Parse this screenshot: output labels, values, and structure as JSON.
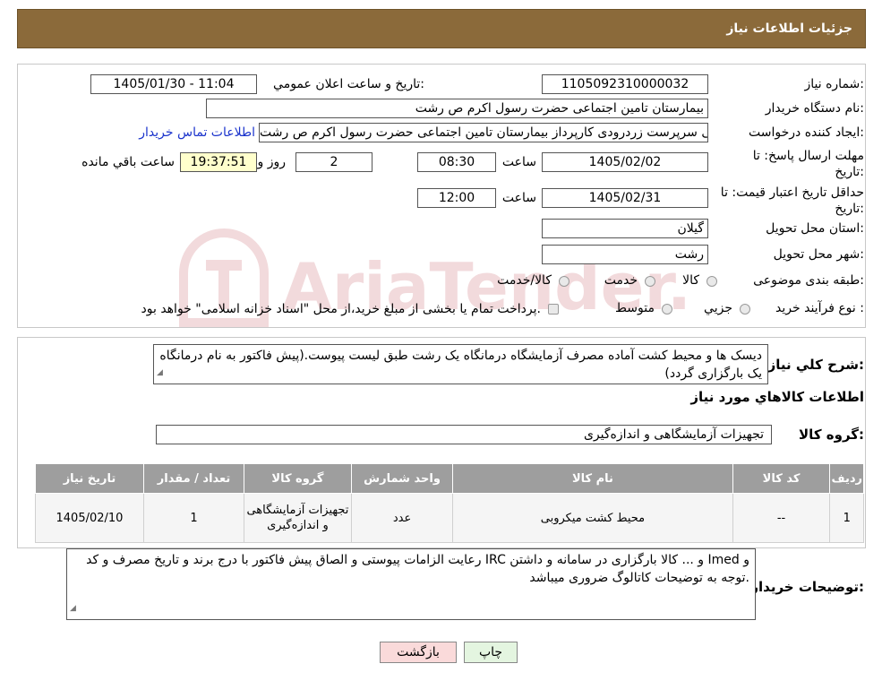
{
  "header": {
    "title": "جزئیات اطلاعات نیاز"
  },
  "fields": {
    "need_number_label": "شماره نیاز:",
    "need_number_value": "1105092310000032",
    "announce_label": "تاريخ و ساعت اعلان عمومي:",
    "announce_value": "1405/01/30 - 11:04",
    "buyer_org_label": "نام دستگاه خريدار:",
    "buyer_org_value": "بیمارستان  تامین اجتماعی حضرت رسول اکرم ص رشت",
    "requester_label": "ايجاد کننده درخواست:",
    "requester_value": "علی سرپرست زردرودی کارپرداز بیمارستان  تامین اجتماعی حضرت رسول اکرم ص رشت",
    "contact_link": "اطلاعات تماس خريدار",
    "deadline_label_1": "مهلت ارسال پاسخ: تا",
    "deadline_label_2": "تاريخ:",
    "deadline_date": "1405/02/02",
    "time_label": "ساعت",
    "deadline_time": "08:30",
    "days_value": "2",
    "days_label": "روز و",
    "remaining_time": "19:37:51",
    "remaining_label": "ساعت باقي مانده",
    "validity_label_1": "حداقل تاريخ اعتبار قيمت: تا",
    "validity_label_2": "تاريخ:",
    "validity_date": "1405/02/31",
    "validity_time": "12:00",
    "province_label": "استان محل تحويل:",
    "province_value": "گيلان",
    "city_label": "شهر محل تحويل:",
    "city_value": "رشت",
    "category_label": "طبقه بندی موضوعی:",
    "category_options": [
      "کالا",
      "خدمت",
      "کالا/خدمت"
    ],
    "process_label": "نوع فرآيند خريد :",
    "process_options": [
      "جزيي",
      "متوسط"
    ],
    "process_note": "پرداخت تمام يا بخشی از مبلغ خريد،از محل \"اسناد خزانه اسلامی\" خواهد بود."
  },
  "description": {
    "label": "شرح کلي نياز:",
    "text": "دیسک ها و محیط کشت آماده مصرف  آزمایشگاه درمانگاه یک رشت طبق لیست پیوست.(پیش فاکتور به نام درمانگاه یک بارگزاری گردد)"
  },
  "goods_info": {
    "heading": "اطلاعات کالاهاي مورد نياز",
    "group_label": "گروه کالا:",
    "group_value": "تجهیزات آزمایشگاهی و اندازه‌گیری"
  },
  "table": {
    "headers": [
      "رديف",
      "کد کالا",
      "نام کالا",
      "واحد شمارش",
      "گروه کالا",
      "تعداد / مقدار",
      "تاريخ نياز"
    ],
    "rows": [
      [
        "1",
        "--",
        "محیط کشت میکروبی",
        "عدد",
        "تجهیزات آزمایشگاهی و اندازه‌گیری",
        "1",
        "1405/02/10"
      ]
    ]
  },
  "buyer_notes": {
    "label": "توضيحات خريدار:",
    "text": "رعایت الزامات پیوستی و الصاق پیش فاکتور با درج برند و تاریخ مصرف و کد IRC و ... کالا بارگزاری در سامانه و داشتن Imed و توجه به توضیحات کاتالوگ ضروری میباشد."
  },
  "buttons": {
    "print": "چاپ",
    "back": "بازگشت"
  },
  "watermark_text": "AriaTender.neT",
  "colors": {
    "header_bg": "#8b6a3a",
    "table_header_bg": "#9e9e9e",
    "timer_bg": "#ffffcc",
    "back_button_bg": "#fadada",
    "print_button_bg": "#e4f5e0",
    "link": "#1a33cc"
  }
}
